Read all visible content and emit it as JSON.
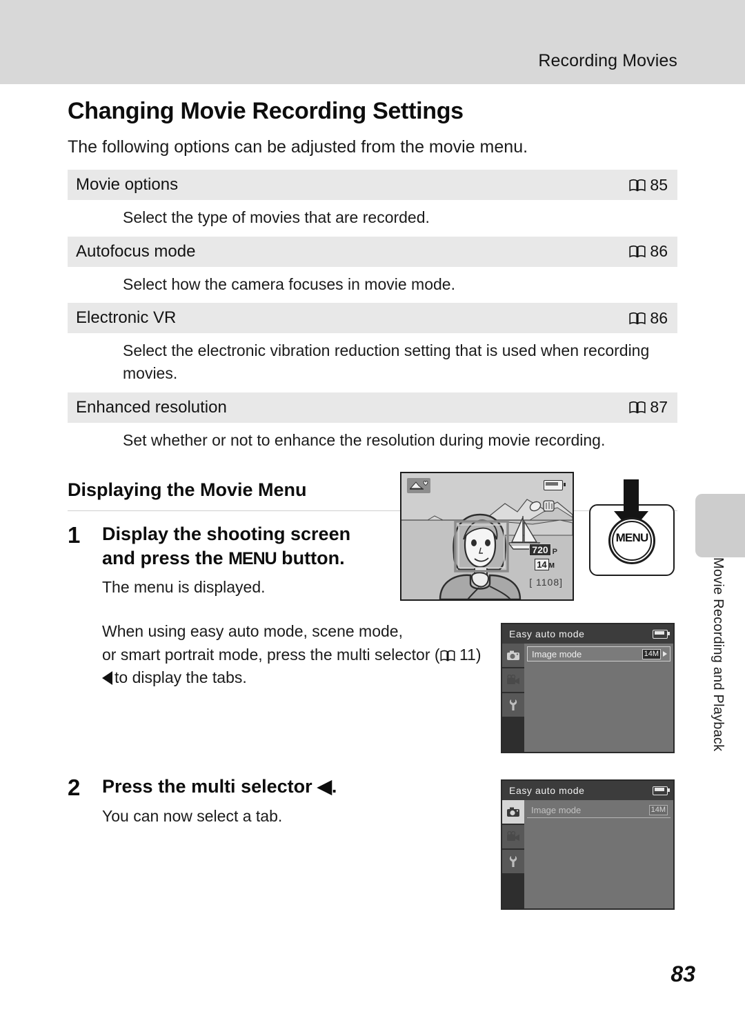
{
  "header": {
    "running_head": "Recording Movies"
  },
  "page": {
    "heading": "Changing Movie Recording Settings",
    "intro": "The following options can be adjusted from the movie menu.",
    "page_number": "83"
  },
  "options_table": {
    "rows": [
      {
        "name": "Movie options",
        "page_ref": "85",
        "description": "Select the type of movies that are recorded."
      },
      {
        "name": "Autofocus mode",
        "page_ref": "86",
        "description": "Select how the camera focuses in movie mode."
      },
      {
        "name": "Electronic VR",
        "page_ref": "86",
        "description": "Select the electronic vibration reduction setting that is used when recording movies."
      },
      {
        "name": "Enhanced resolution",
        "page_ref": "87",
        "description": "Set whether or not to enhance the resolution during movie recording."
      }
    ]
  },
  "subsection": {
    "heading": "Displaying the Movie Menu"
  },
  "steps": [
    {
      "number": "1",
      "title_before": "Display the shooting screen and press the ",
      "title_menu_word": "MENU",
      "title_after": " button.",
      "note": "The menu is displayed.",
      "extra_line1": "When using easy auto mode, scene mode,",
      "extra_line2_a": "or smart portrait mode, press the multi selector (",
      "extra_line2_ref": "11)",
      "extra_line3": "to display the tabs."
    },
    {
      "number": "2",
      "title": "Press the multi selector ◀.",
      "note": "You can now select a tab."
    }
  ],
  "lcd_display": {
    "mode_icon": "easy-auto-mode-icon",
    "battery_icon": "battery-icon",
    "movie_quality": "720",
    "movie_quality_suffix": "P",
    "image_size": "14",
    "image_size_suffix": "M",
    "shots_remaining": "[ 1108]"
  },
  "menu_button": {
    "label": "MENU",
    "arrow_icon": "down-arrow-icon"
  },
  "camera_menu_screens": [
    {
      "title": "Easy auto mode",
      "battery_icon": "battery-icon",
      "tabs": [
        {
          "icon": "camera-tab-icon",
          "selected": false
        },
        {
          "icon": "movie-tab-icon",
          "selected": false
        },
        {
          "icon": "wrench-tab-icon",
          "selected": false
        }
      ],
      "item_label": "Image mode",
      "item_value": "14",
      "item_value_suffix": "M",
      "item_state": "boxed"
    },
    {
      "title": "Easy auto mode",
      "battery_icon": "battery-icon",
      "tabs": [
        {
          "icon": "camera-tab-icon",
          "selected": true
        },
        {
          "icon": "movie-tab-icon",
          "selected": false
        },
        {
          "icon": "wrench-tab-icon",
          "selected": false
        }
      ],
      "item_label": "Image mode",
      "item_value": "14",
      "item_value_suffix": "M",
      "item_state": "plain"
    }
  ],
  "side_tab": {
    "label": "Movie Recording and Playback"
  },
  "colors": {
    "header_band": "#d8d8d8",
    "table_row": "#e8e8e8",
    "side_tab": "#cdcdcd",
    "menu_dark": "#3c3c3c",
    "menu_pane": "#737373"
  }
}
